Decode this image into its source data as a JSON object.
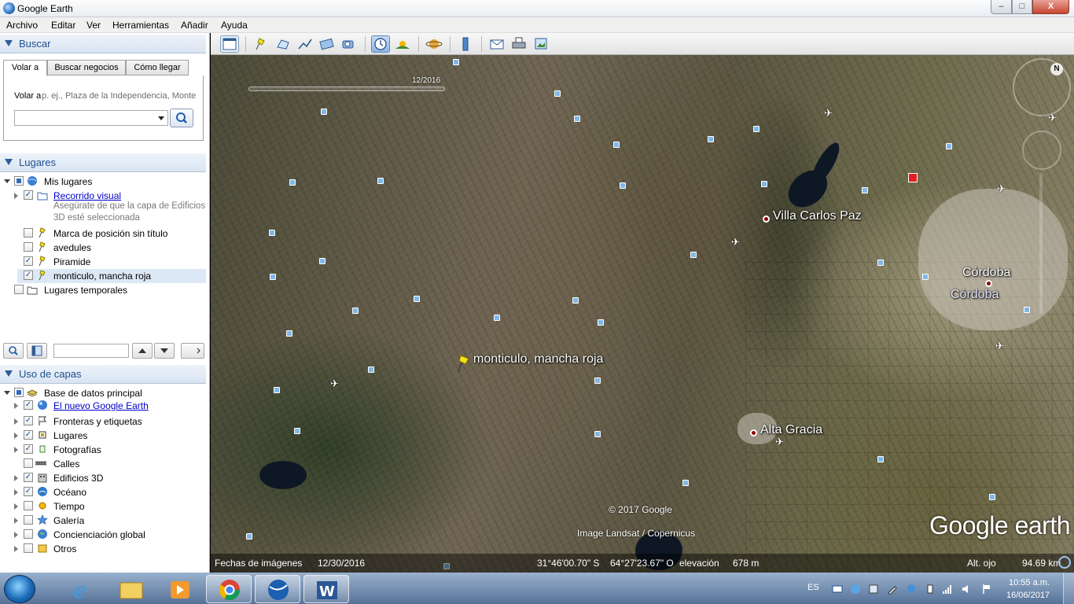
{
  "window": {
    "title": "Google Earth",
    "min_label": "–",
    "max_label": "□",
    "close_label": "X"
  },
  "menu": [
    "Archivo",
    "Editar",
    "Ver",
    "Herramientas",
    "Añadir",
    "Ayuda"
  ],
  "search": {
    "header": "Buscar",
    "tabs": [
      "Volar a",
      "Buscar negocios",
      "Cómo llegar"
    ],
    "fly_label": "Volar a",
    "fly_hint": "p. ej., Plaza de la Independencia, Monte",
    "input_value": ""
  },
  "places": {
    "header": "Lugares",
    "items": [
      {
        "label": "Mis lugares"
      },
      {
        "label": "Recorrido visual",
        "note1": "Asegúrate de que la capa de Edificios",
        "note2": "3D esté seleccionada"
      },
      {
        "label": "Marca de posición sin título"
      },
      {
        "label": "avedules"
      },
      {
        "label": "Piramide"
      },
      {
        "label": "monticulo, mancha roja"
      },
      {
        "label": "Lugares temporales"
      }
    ],
    "search_value": ""
  },
  "layers": {
    "header": "Uso de capas",
    "items": [
      {
        "label": "Base de datos principal"
      },
      {
        "label": "El nuevo Google Earth"
      },
      {
        "label": "Fronteras y etiquetas"
      },
      {
        "label": "Lugares"
      },
      {
        "label": "Fotografías"
      },
      {
        "label": "Calles"
      },
      {
        "label": "Edificios 3D"
      },
      {
        "label": "Océano"
      },
      {
        "label": "Tiempo"
      },
      {
        "label": "Galería"
      },
      {
        "label": "Concienciación global"
      },
      {
        "label": "Otros"
      }
    ]
  },
  "map": {
    "time_slider_date": "12/2016",
    "labels": {
      "placemark": "monticulo, mancha roja",
      "villa_carlos_paz": "Villa Carlos Paz",
      "cordoba_1": "Córdoba",
      "cordoba_2": "Córdoba",
      "alta_gracia": "Alta Gracia"
    },
    "copyright": "© 2017 Google",
    "imagery_credit": "Image Landsat / Copernicus",
    "brand": "Google earth",
    "compass_letter": "N"
  },
  "status": {
    "imagery_date_label": "Fechas de imágenes",
    "imagery_date": "12/30/2016",
    "lat": "31°46'00.70\" S",
    "lon": "64°27'23.67\" O",
    "elevation_label": "elevación",
    "elevation": "678 m",
    "eye_alt_label": "Alt. ojo",
    "eye_alt": "94.69 km"
  },
  "taskbar": {
    "language": "ES",
    "time": "10:55 a.m.",
    "date": "16/06/2017"
  },
  "colors": {
    "panel_header_text": "#1f4f8f",
    "map_label": "#ffffff",
    "city_dot": "#8b0000",
    "pin_yellow": "#f2e21c",
    "link_blue": "#0000cc"
  }
}
